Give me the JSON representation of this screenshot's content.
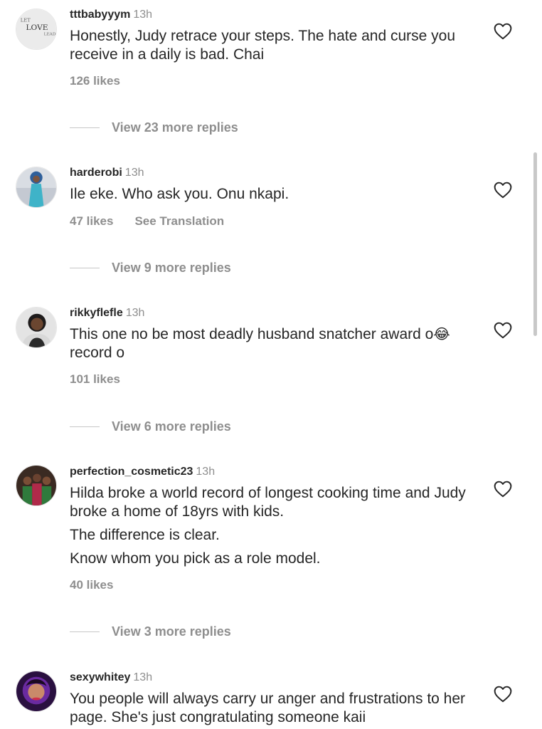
{
  "comments": [
    {
      "username": "tttbabyyym",
      "time": "13h",
      "lines": [
        "Honestly, Judy retrace your steps. The hate and curse you receive in a daily is bad. Chai"
      ],
      "likes": "126 likes",
      "translation": "",
      "replies": "View 23 more replies",
      "avatar_text": [
        "LET",
        "LOVE",
        "LEAD"
      ]
    },
    {
      "username": "harderobi",
      "time": "13h",
      "lines": [
        "Ile eke. Who ask you. Onu nkapi."
      ],
      "likes": "47 likes",
      "translation": "See Translation",
      "replies": "View 9 more replies"
    },
    {
      "username": "rikkyflefle",
      "time": "13h",
      "lines_parts": [
        "This one no be most deadly husband snatcher award o",
        "😂",
        " record o"
      ],
      "likes": "101 likes",
      "translation": "",
      "replies": "View 6 more replies"
    },
    {
      "username": "perfection_cosmetic23",
      "time": "13h",
      "lines": [
        "Hilda broke a world record of longest cooking time and Judy broke a home of 18yrs with kids.",
        "The difference is clear.",
        "Know whom you pick as a role model."
      ],
      "likes": "40 likes",
      "translation": "",
      "replies": "View 3 more replies"
    },
    {
      "username": "sexywhitey",
      "time": "13h",
      "lines": [
        "You people will always carry ur anger and frustrations to her page. She's just congratulating someone kaii"
      ],
      "likes": "",
      "translation": "",
      "replies": ""
    }
  ],
  "icons": {
    "like": "heart-outline-icon"
  },
  "colors": {
    "text": "#262626",
    "muted": "#8e8e8e",
    "divider": "#c7c7c7"
  }
}
